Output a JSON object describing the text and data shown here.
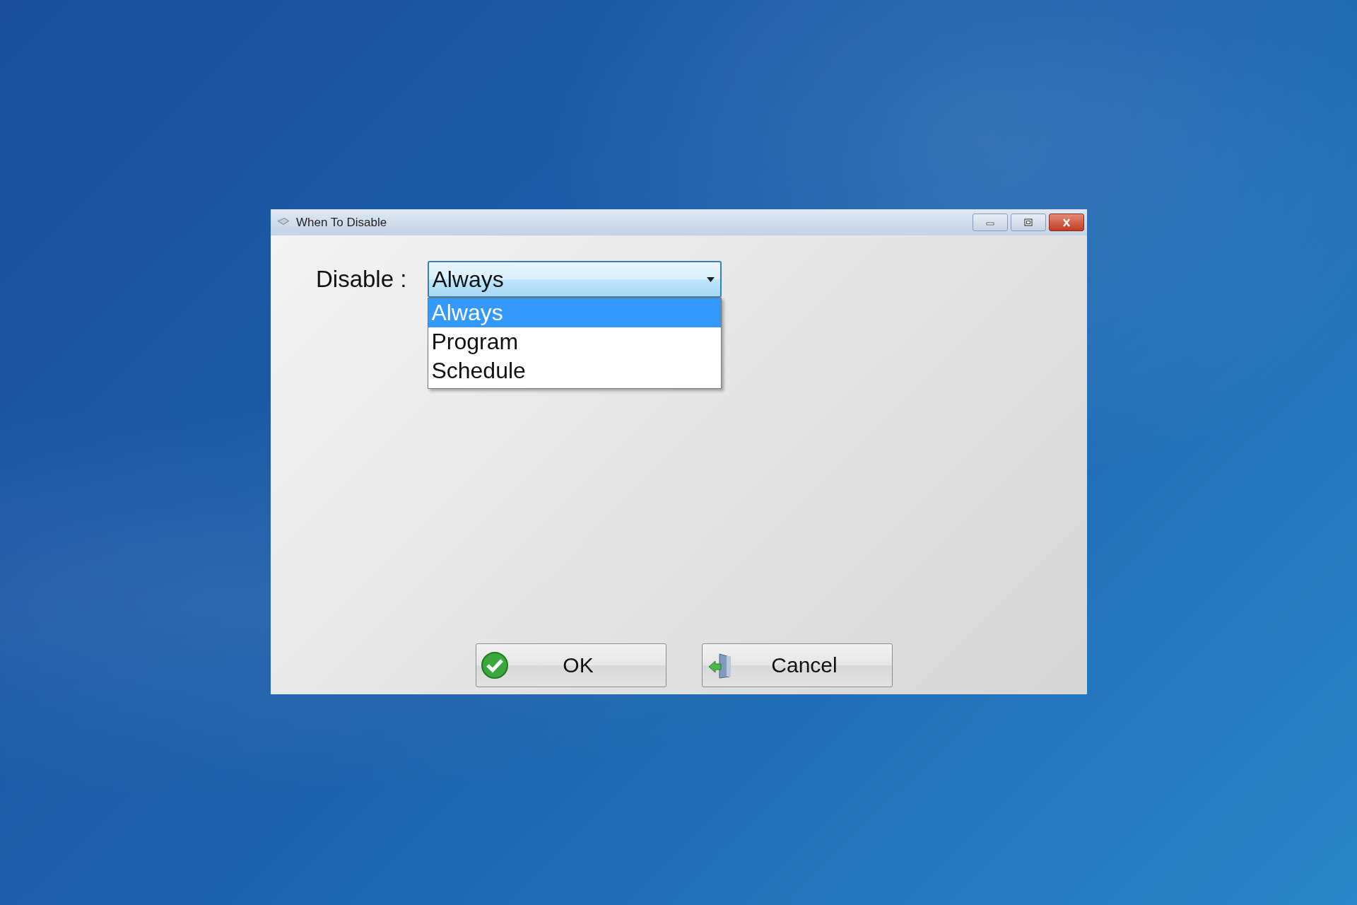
{
  "window": {
    "title": "When To Disable"
  },
  "field": {
    "label": "Disable :",
    "value": "Always",
    "expanded": true
  },
  "options": [
    {
      "label": "Always",
      "selected": true
    },
    {
      "label": "Program",
      "selected": false
    },
    {
      "label": "Schedule",
      "selected": false
    }
  ],
  "buttons": [
    {
      "label": "OK",
      "kind": "ok"
    },
    {
      "label": "Cancel",
      "kind": "cancel"
    }
  ]
}
